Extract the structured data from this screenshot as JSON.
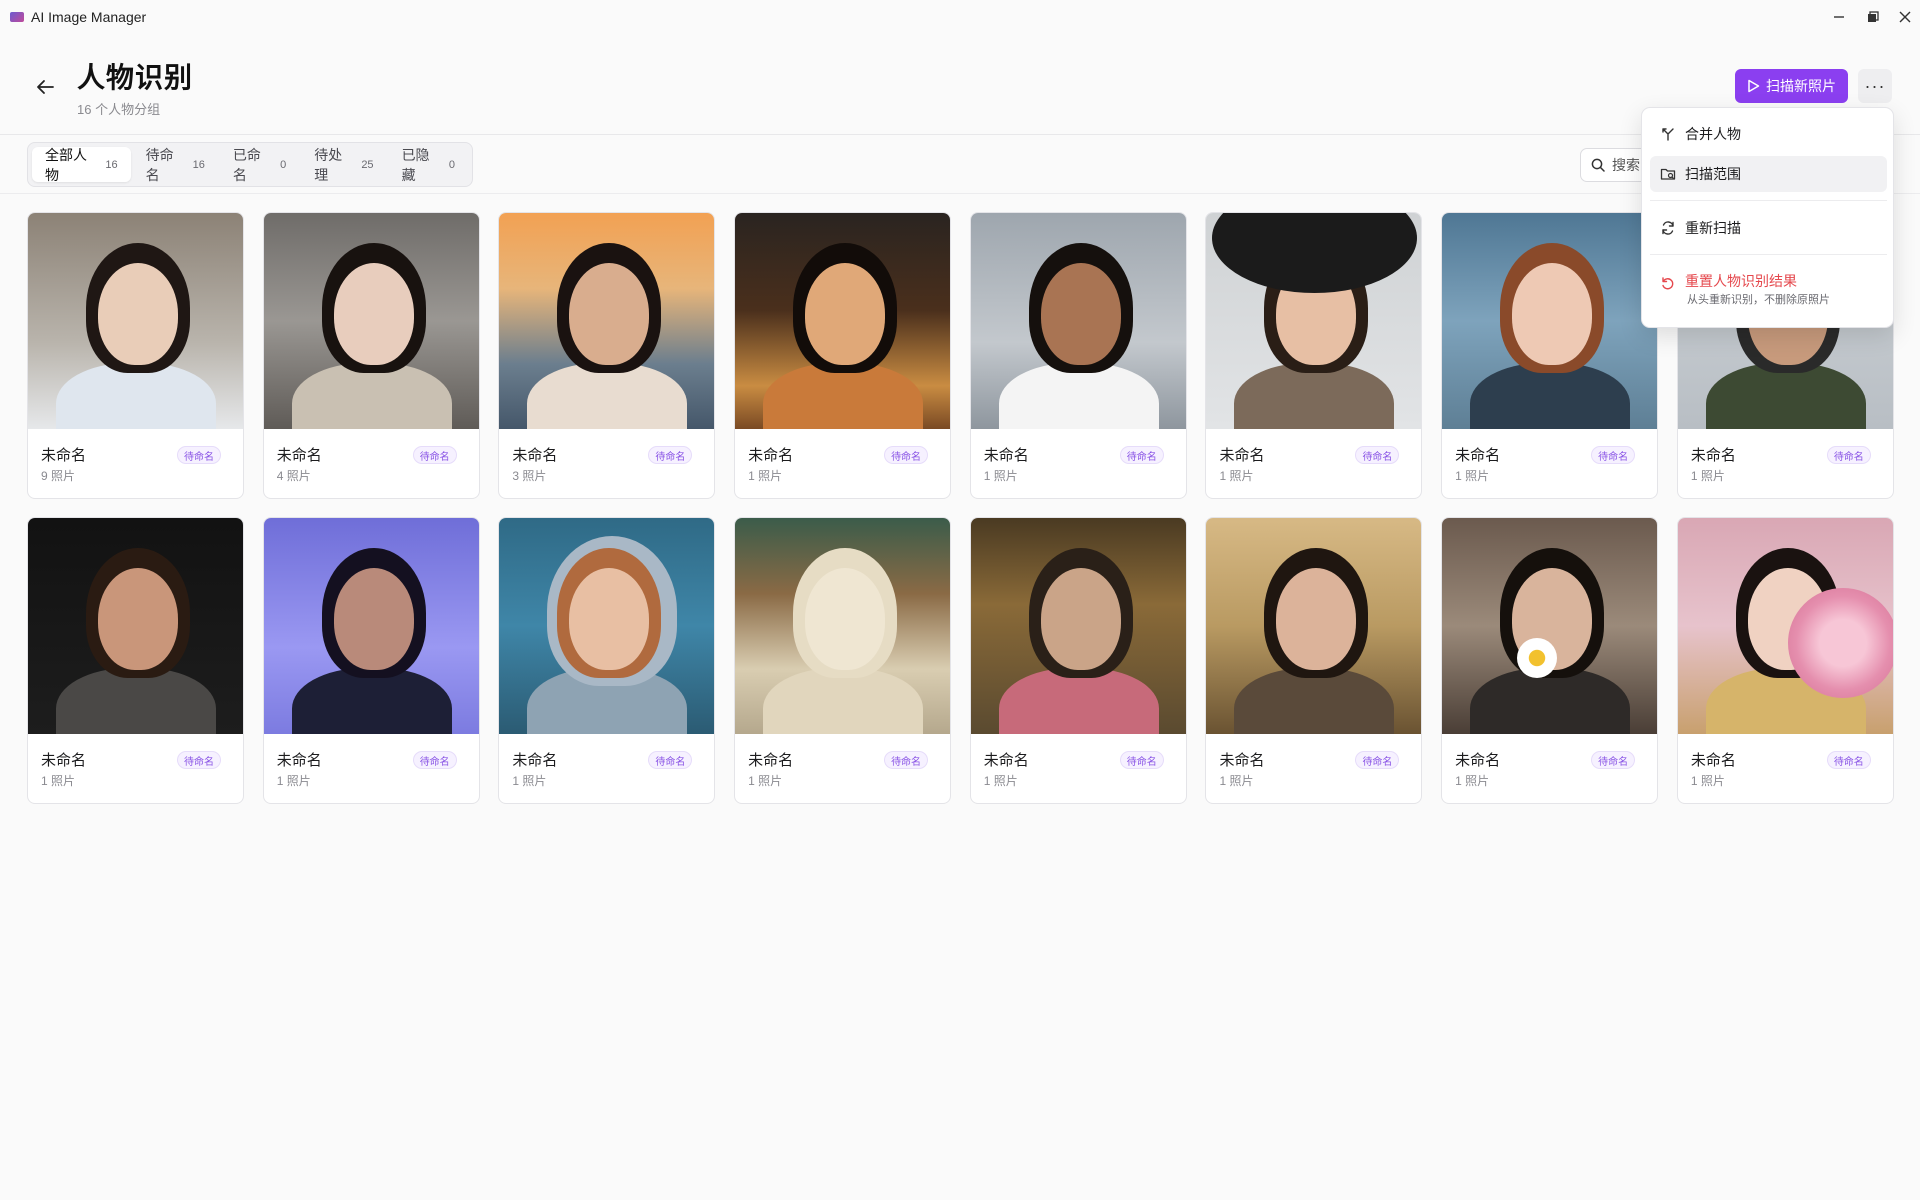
{
  "window": {
    "title": "AI Image Manager"
  },
  "header": {
    "title": "人物识别",
    "subtitle": "16 个人物分组",
    "scan_label": "扫描新照片",
    "more_label": "···"
  },
  "tabs": [
    {
      "label": "全部人物",
      "count": "16",
      "active": true
    },
    {
      "label": "待命名",
      "count": "16",
      "active": false
    },
    {
      "label": "已命名",
      "count": "0",
      "active": false
    },
    {
      "label": "待处理",
      "count": "25",
      "active": false
    },
    {
      "label": "已隐藏",
      "count": "0",
      "active": false
    }
  ],
  "search": {
    "placeholder": "搜索"
  },
  "menu": {
    "merge_label": "合并人物",
    "scope_label": "扫描范围",
    "rescan_label": "重新扫描",
    "reset_label": "重置人物识别结果",
    "reset_sub": "从头重新识别，不删除原照片"
  },
  "people": [
    {
      "name": "未命名",
      "photos": "9 照片",
      "badge": "待命名"
    },
    {
      "name": "未命名",
      "photos": "4 照片",
      "badge": "待命名"
    },
    {
      "name": "未命名",
      "photos": "3 照片",
      "badge": "待命名"
    },
    {
      "name": "未命名",
      "photos": "1 照片",
      "badge": "待命名"
    },
    {
      "name": "未命名",
      "photos": "1 照片",
      "badge": "待命名"
    },
    {
      "name": "未命名",
      "photos": "1 照片",
      "badge": "待命名"
    },
    {
      "name": "未命名",
      "photos": "1 照片",
      "badge": "待命名"
    },
    {
      "name": "未命名",
      "photos": "1 照片",
      "badge": "待命名"
    },
    {
      "name": "未命名",
      "photos": "1 照片",
      "badge": "待命名"
    },
    {
      "name": "未命名",
      "photos": "1 照片",
      "badge": "待命名"
    },
    {
      "name": "未命名",
      "photos": "1 照片",
      "badge": "待命名"
    },
    {
      "name": "未命名",
      "photos": "1 照片",
      "badge": "待命名"
    },
    {
      "name": "未命名",
      "photos": "1 照片",
      "badge": "待命名"
    },
    {
      "name": "未命名",
      "photos": "1 照片",
      "badge": "待命名"
    },
    {
      "name": "未命名",
      "photos": "1 照片",
      "badge": "待命名"
    },
    {
      "name": "未命名",
      "photos": "1 照片",
      "badge": "待命名"
    }
  ],
  "colors": {
    "accent": "#8b3ff0",
    "badge_text": "#8a55e6",
    "danger": "#e5484d"
  }
}
